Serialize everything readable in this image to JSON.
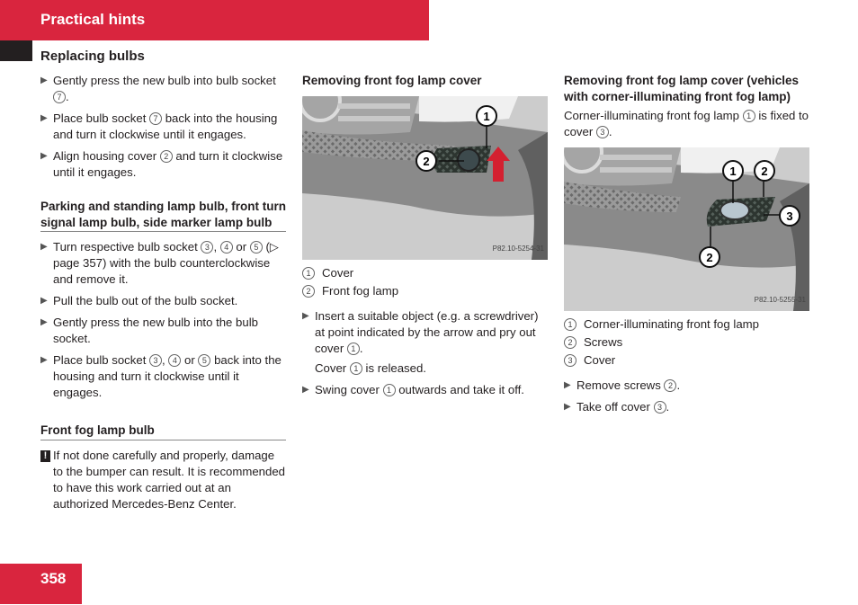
{
  "header": {
    "title": "Practical hints"
  },
  "section": {
    "title": "Replacing bulbs"
  },
  "col1": {
    "steps_a": [
      {
        "text": "Gently press the new bulb into bulb socket",
        "refs": [
          "7"
        ],
        "suffix": "."
      },
      {
        "text": "Place bulb socket",
        "refs": [
          "7"
        ],
        "suffix": " back into the housing and turn it clockwise until it engages."
      },
      {
        "text": "Align housing cover",
        "refs": [
          "2"
        ],
        "suffix": " and turn it clockwise until it engages."
      }
    ],
    "subhead_parking": "Parking and standing lamp bulb, front turn signal lamp bulb, side marker lamp bulb",
    "steps_b": [
      {
        "text": "Turn respective bulb socket",
        "refs": [
          "3",
          "4",
          "5"
        ],
        "suffix": " (▷ page 357) with the bulb counterclockwise and remove it."
      },
      {
        "text": "Pull the bulb out of the bulb socket.",
        "refs": [],
        "suffix": ""
      },
      {
        "text": "Gently press the new bulb into the bulb socket.",
        "refs": [],
        "suffix": ""
      },
      {
        "text": "Place bulb socket",
        "refs": [
          "3",
          "4",
          "5"
        ],
        "suffix": " back into the housing and turn it clockwise until it engages."
      }
    ],
    "subhead_fog": "Front fog lamp bulb",
    "warning": "If not done carefully and properly, damage to the bumper can result. It is recommended to have this work carried out at an authorized Mercedes-Benz Center."
  },
  "col2": {
    "subhead": "Removing front fog lamp cover",
    "figure_code": "P82.10-5254-31",
    "legend": [
      {
        "n": "1",
        "label": "Cover"
      },
      {
        "n": "2",
        "label": "Front fog lamp"
      }
    ],
    "step1_a": "Insert a suitable object (e.g. a screwdriver) at point indicated by the arrow and pry out cover",
    "step1_ref": "1",
    "result_a": "Cover",
    "result_ref": "1",
    "result_b": "is released.",
    "step2_a": "Swing cover",
    "step2_ref": "1",
    "step2_b": "outwards and take it off."
  },
  "col3": {
    "subhead": "Removing front fog lamp cover (vehicles with corner-illuminating front fog lamp)",
    "intro_a": "Corner-illuminating front fog lamp",
    "intro_ref1": "1",
    "intro_b": "is fixed to cover",
    "intro_ref2": "3",
    "figure_code": "P82.10-5255-31",
    "legend": [
      {
        "n": "1",
        "label": "Corner-illuminating front fog lamp"
      },
      {
        "n": "2",
        "label": "Screws"
      },
      {
        "n": "3",
        "label": "Cover"
      }
    ],
    "step1_a": "Remove screws",
    "step1_ref": "2",
    "step2_a": "Take off cover",
    "step2_ref": "3"
  },
  "footer": {
    "page_number": "358"
  },
  "icons": {
    "step_arrow": "▶",
    "warning": "!"
  },
  "colors": {
    "brand_red": "#d9253e",
    "dark": "#231f20",
    "arrow_red": "#d42030"
  }
}
